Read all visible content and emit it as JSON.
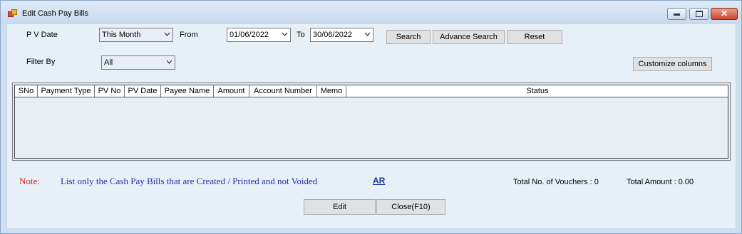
{
  "window": {
    "title": "Edit Cash Pay Bills",
    "controls": {
      "minimize": "min",
      "maximize": "max",
      "close": "✕"
    }
  },
  "filters": {
    "pv_date_label": "P V Date",
    "pv_date_value": "This Month",
    "from_label": "From",
    "from_value": "01/06/2022",
    "to_label": "To",
    "to_value": "30/06/2022",
    "filter_by_label": "Filter By",
    "filter_by_value": "All"
  },
  "buttons": {
    "search": "Search",
    "advance_search": "Advance Search",
    "reset": "Reset",
    "customize_columns": "Customize columns",
    "edit": "Edit",
    "close": "Close(F10)"
  },
  "grid": {
    "columns": [
      "SNo",
      "Payment Type",
      "PV No",
      "PV Date",
      "Payee Name",
      "Amount",
      "Account Number",
      "Memo",
      "Status"
    ],
    "rows": []
  },
  "footer": {
    "note_label": "Note:",
    "note_text": "List only the Cash Pay Bills that are Created / Printed and not Voided",
    "ar_link": "AR",
    "total_vouchers": "Total No. of Vouchers : 0",
    "total_amount": "Total Amount : 0.00"
  },
  "colors": {
    "note_label": "#c62828",
    "note_text": "#1d2fa3",
    "background": "#e8f0f7"
  },
  "icons": [
    "app-icon",
    "chevron-down-icon",
    "minimize-icon",
    "maximize-icon",
    "close-icon"
  ]
}
